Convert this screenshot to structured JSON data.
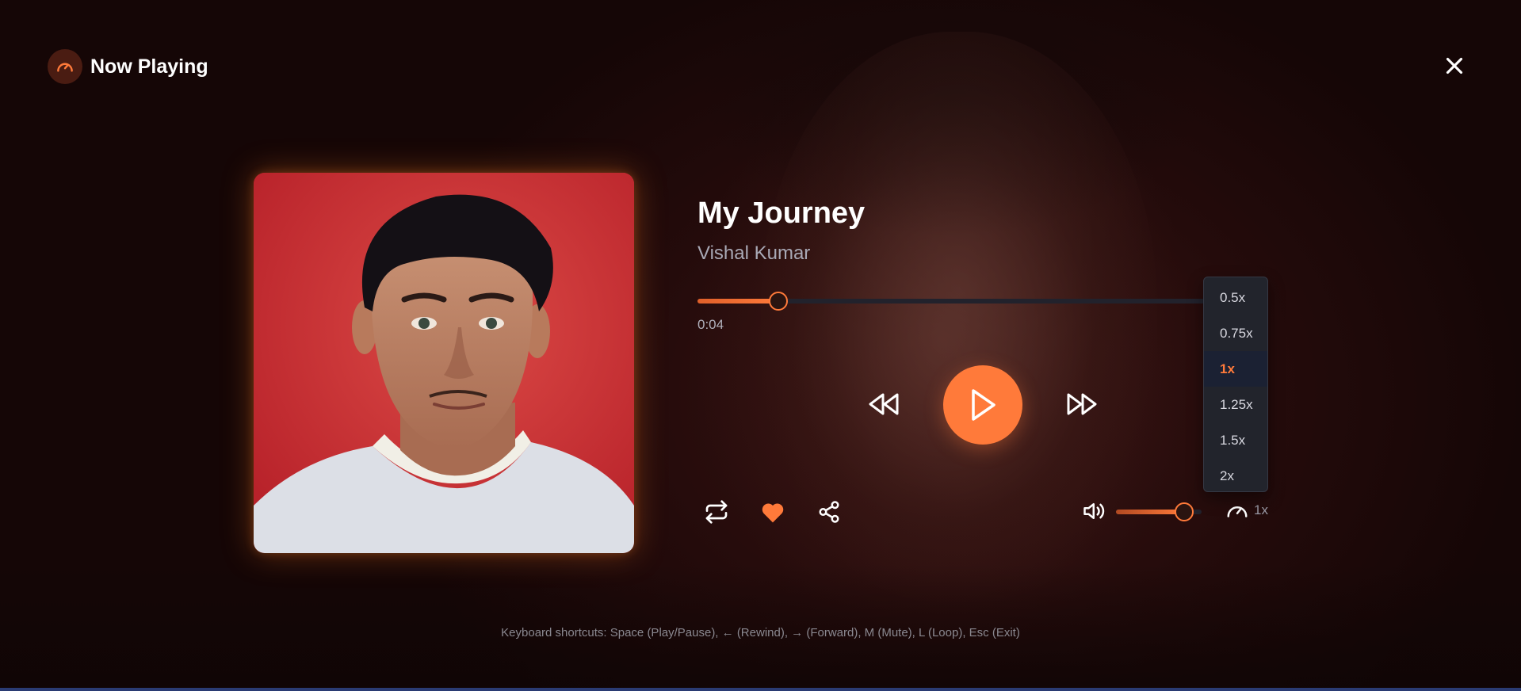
{
  "header": {
    "title": "Now Playing",
    "logo_icon": "gauge-icon"
  },
  "track": {
    "title": "My Journey",
    "artist": "Vishal Kumar",
    "current_time": "0:04",
    "progress_fraction": 0.16
  },
  "controls": {
    "rewind_icon": "rewind-icon",
    "play_icon": "play-icon",
    "forward_icon": "fast-forward-icon",
    "repeat_icon": "repeat-icon",
    "like_icon": "heart-icon",
    "share_icon": "share-icon",
    "close_icon": "close-icon"
  },
  "volume": {
    "icon": "volume-icon",
    "level_fraction": 0.8
  },
  "speed": {
    "current_label": "1x",
    "options": [
      "0.5x",
      "0.75x",
      "1x",
      "1.25x",
      "1.5x",
      "2x"
    ],
    "selected_index": 2
  },
  "footer": {
    "shortcuts": "Keyboard shortcuts: Space (Play/Pause), ← (Rewind), → (Forward), M (Mute), L (Loop), Esc (Exit)"
  },
  "colors": {
    "accent": "#ff7a3a",
    "background": "#140606",
    "menu_background": "#22242c"
  }
}
